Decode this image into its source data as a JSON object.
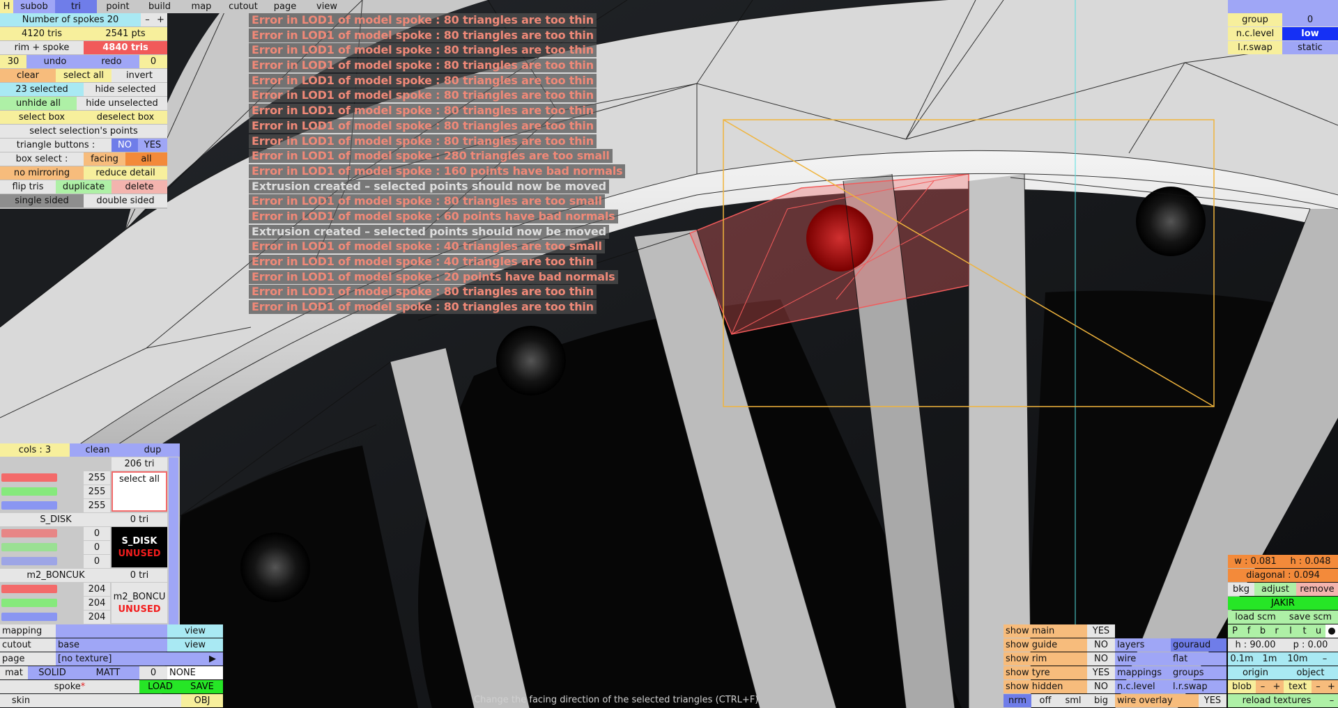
{
  "top_menu": {
    "h": "H",
    "subob": "subob",
    "tri": "tri",
    "point": "point",
    "build": "build",
    "map": "map",
    "cutout": "cutout",
    "page": "page",
    "view": "view"
  },
  "left_panel": {
    "spokes_label": "Number of spokes 20",
    "minus": "–",
    "plus": "+",
    "tris": "4120 tris",
    "pts": "2541 pts",
    "rim_spoke": "rim + spoke",
    "rim_spoke_tris": "4840 tris",
    "undo_count": "30",
    "undo": "undo",
    "redo": "redo",
    "redo_count": "0",
    "clear": "clear",
    "select_all": "select all",
    "invert": "invert",
    "selected": "23 selected",
    "hide_selected": "hide selected",
    "unhide_all": "unhide all",
    "hide_unselected": "hide unselected",
    "select_box": "select box",
    "deselect_box": "deselect box",
    "select_points": "select selection's points",
    "tri_buttons": "triangle buttons :",
    "no": "NO",
    "yes": "YES",
    "box_select": "box select :",
    "facing": "facing",
    "all": "all",
    "no_mirroring": "no mirroring",
    "reduce_detail": "reduce detail",
    "flip_tris": "flip tris",
    "duplicate": "duplicate",
    "delete": "delete",
    "single_sided": "single sided",
    "double_sided": "double sided"
  },
  "errors": [
    {
      "text": "Error in LOD1 of model spoke : 80 triangles are too thin",
      "type": "error"
    },
    {
      "text": "Error in LOD1 of model spoke : 80 triangles are too thin",
      "type": "error"
    },
    {
      "text": "Error in LOD1 of model spoke : 80 triangles are too thin",
      "type": "error"
    },
    {
      "text": "Error in LOD1 of model spoke : 80 triangles are too thin",
      "type": "error"
    },
    {
      "text": "Error in LOD1 of model spoke : 80 triangles are too thin",
      "type": "error"
    },
    {
      "text": "Error in LOD1 of model spoke : 80 triangles are too thin",
      "type": "error"
    },
    {
      "text": "Error in LOD1 of model spoke : 80 triangles are too thin",
      "type": "error"
    },
    {
      "text": "Error in LOD1 of model spoke : 80 triangles are too thin",
      "type": "error"
    },
    {
      "text": "Error in LOD1 of model spoke : 80 triangles are too thin",
      "type": "error"
    },
    {
      "text": "Error in LOD1 of model spoke : 280 triangles are too small",
      "type": "error"
    },
    {
      "text": "Error in LOD1 of model spoke : 160 points have bad normals",
      "type": "error"
    },
    {
      "text": "Extrusion created – selected points should now be moved",
      "type": "info"
    },
    {
      "text": "Error in LOD1 of model spoke : 80 triangles are too small",
      "type": "error"
    },
    {
      "text": "Error in LOD1 of model spoke : 60 points have bad normals",
      "type": "error"
    },
    {
      "text": "Extrusion created – selected points should now be moved",
      "type": "info"
    },
    {
      "text": "Error in LOD1 of model spoke : 40 triangles are too small",
      "type": "error"
    },
    {
      "text": "Error in LOD1 of model spoke : 40 triangles are too thin",
      "type": "error"
    },
    {
      "text": "Error in LOD1 of model spoke : 20 points have bad normals",
      "type": "error"
    },
    {
      "text": "Error in LOD1 of model spoke : 80 triangles are too thin",
      "type": "error"
    },
    {
      "text": "Error in LOD1 of model spoke : 80 triangles are too thin",
      "type": "error"
    }
  ],
  "top_right": {
    "group": "group",
    "group_val": "0",
    "nc_level": "n.c.level",
    "nc_level_val": "low",
    "lr_swap": "l.r.swap",
    "lr_swap_val": "static"
  },
  "materials": {
    "cols": "cols : 3",
    "clean": "clean",
    "dup": "dup",
    "tri206": "206 tri",
    "select_all": "select all",
    "rgb1": [
      "255",
      "255",
      "255"
    ],
    "s_disk": "S_DISK",
    "s_disk_tri": "0 tri",
    "s_disk_name": "S_DISK",
    "unused": "UNUSED",
    "rgb2": [
      "0",
      "0",
      "0"
    ],
    "m2": "m2_BONCUK",
    "m2_tri": "0 tri",
    "m2_name": "m2_BONCU",
    "rgb3": [
      "204",
      "204",
      "204"
    ]
  },
  "bottom_left": {
    "mapping": "mapping",
    "view1": "view",
    "cutout": "cutout",
    "base": "base",
    "view2": "view",
    "page": "page",
    "no_texture": "[no texture]",
    "play": "▶",
    "mat": "mat",
    "solid": "SOLID",
    "matt": "MATT",
    "zero": "0",
    "none": "NONE",
    "spoke": "spoke",
    "star": "*",
    "load": "LOAD",
    "save": "SAVE",
    "skin": "skin",
    "obj": "OBJ"
  },
  "status": "Change the facing direction of the selected triangles (CTRL+F)",
  "bottom_mid": {
    "show_main": "show main",
    "show_main_v": "YES",
    "show_guide": "show guide",
    "show_guide_v": "NO",
    "show_rim": "show rim",
    "show_rim_v": "NO",
    "show_tyre": "show tyre",
    "show_tyre_v": "YES",
    "show_hidden": "show hidden",
    "show_hidden_v": "NO",
    "nrm": "nrm",
    "off": "off",
    "sml": "sml",
    "big": "big",
    "layers": "layers",
    "gouraud": "gouraud",
    "wire": "wire",
    "flat": "flat",
    "mappings": "mappings",
    "groups": "groups",
    "nclevel": "n.c.level",
    "lrswap": "l.r.swap",
    "wire_overlay": "wire overlay",
    "wire_overlay_v": "YES"
  },
  "bottom_right": {
    "w": "w : 0.081",
    "h": "h : 0.048",
    "diagonal": "diagonal : 0.094",
    "bkg": "bkg",
    "adjust": "adjust",
    "remove": "remove",
    "jakir": "JAKIR",
    "load_scm": "load scm",
    "save_scm": "save scm",
    "views": [
      "P",
      "f",
      "b",
      "r",
      "l",
      "t",
      "u",
      "●"
    ],
    "h90": "h : 90.00",
    "p0": "p : 0.00",
    "s01": "0.1m",
    "s1": "1m",
    "s10": "10m",
    "sdash": "–",
    "origin": "origin",
    "object": "object",
    "blob": "blob",
    "bminus": "–",
    "bplus": "+",
    "text": "text",
    "tminus": "–",
    "tplus": "+",
    "reload": "reload textures",
    "rminus": "–"
  },
  "colors": {
    "error_text": "#f08978",
    "selection_box": "#f0b43c",
    "selected_tris": "#f25a5a"
  }
}
